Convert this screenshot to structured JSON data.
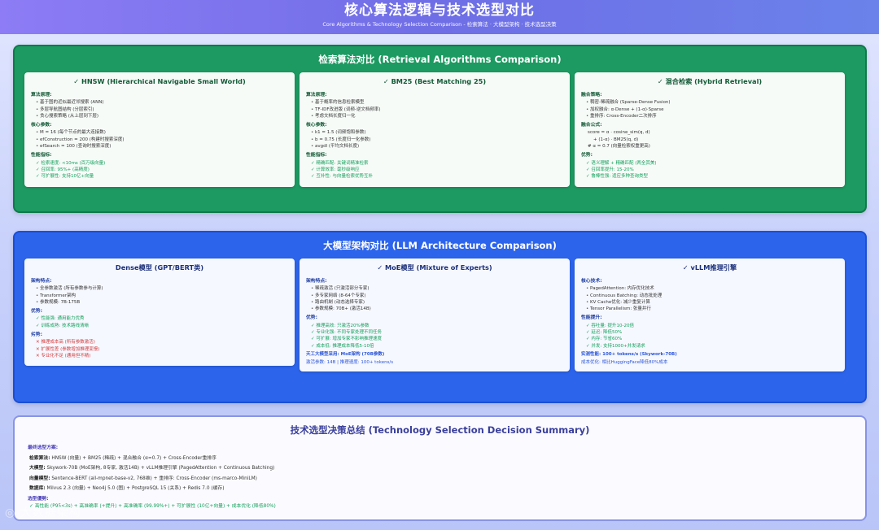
{
  "header": {
    "title": "核心算法逻辑与技术选型对比",
    "subtitle": "Core Algorithms & Technology Selection Comparison - 检索算法 · 大模型架构 · 技术选型决策"
  },
  "retrieval": {
    "title": "检索算法对比 (Retrieval Algorithms Comparison)",
    "cards": [
      {
        "title": "✓ HNSW (Hierarchical Navigable Small World)",
        "s1": "算法原理:",
        "l1": [
          "基于图的近似最近邻搜索 (ANN)",
          "多层导航图结构 (分层索引)",
          "贪心搜索策略 (从上层到下层)"
        ],
        "s2": "核心参数:",
        "l2": [
          "M = 16 (每个节点的最大连接数)",
          "efConstruction = 200 (构建时搜索深度)",
          "efSearch = 100 (查询时搜索深度)"
        ],
        "s3": "性能指标:",
        "l3": [
          "检索速度: <10ms (百万级向量)",
          "召回率: 95%+ (高精度)",
          "可扩展性: 支持10亿+向量"
        ]
      },
      {
        "title": "✓ BM25 (Best Matching 25)",
        "s1": "算法原理:",
        "l1": [
          "基于概率的信息检索模型",
          "TF-IDF改进版 (词频-逆文档频率)",
          "考虑文档长度归一化"
        ],
        "s2": "核心参数:",
        "l2": [
          "k1 = 1.5 (词频饱和参数)",
          "b = 0.75 (长度归一化参数)",
          "avgdl (平均文档长度)"
        ],
        "s3": "性能指标:",
        "l3": [
          "精确匹配: 关键词精准检索",
          "计算效率: 毫秒级响应",
          "互补性: 与向量检索优势互补"
        ]
      },
      {
        "title": "✓ 混合检索 (Hybrid Retrieval)",
        "s1": "融合策略:",
        "l1": [
          "稠密-稀疏融合 (Sparse-Dense Fusion)",
          "加权融合: α·Dense + (1-α)·Sparse",
          "重排序: Cross-Encoder二次排序"
        ],
        "s2": "融合公式:",
        "formula": [
          "score = α · cosine_sim(q, d)",
          "    + (1-α) · BM25(q, d)",
          "# α = 0.7 (向量检索权重更高)"
        ],
        "s3": "优势:",
        "l3": [
          "语义理解 + 精确匹配 (两全其美)",
          "召回率提升: 15-20%",
          "鲁棒性强: 适应多种查询类型"
        ]
      }
    ]
  },
  "llm": {
    "title": "大模型架构对比 (LLM Architecture Comparison)",
    "cards": [
      {
        "title": "Dense模型 (GPT/BERT类)",
        "s1": "架构特点:",
        "l1": [
          "全参数激活 (所有参数参与计算)",
          "Transformer架构",
          "参数规模: 7B-175B"
        ],
        "s2": "优势:",
        "l2": [
          "性能强: 通用能力优秀",
          "训练成熟: 技术路线清晰"
        ],
        "s3": "劣势:",
        "l3": [
          "推理成本高 (所有参数激活)",
          "扩展性差 (参数增加推理变慢)",
          "专业化不足 (通用但不精)"
        ]
      },
      {
        "title": "✓ MoE模型 (Mixture of Experts)",
        "s1": "架构特点:",
        "l1": [
          "稀疏激活 (只激活部分专家)",
          "多专家网络 (8-64个专家)",
          "路由机制 (动态选择专家)",
          "参数规模: 70B+ (激活14B)"
        ],
        "s2": "优势:",
        "l2": [
          "推理高效: 只激活20%参数",
          "专业化强: 不同专家处理不同任务",
          "可扩展: 增加专家不影响推理速度",
          "成本低: 推理成本降低5-10倍"
        ],
        "note1": "天工大模型采用: MoE架构 (70B参数)",
        "note2": "激活参数: 14B | 推理速度: 100+ tokens/s"
      },
      {
        "title": "✓ vLLM推理引擎",
        "s1": "核心技术:",
        "l1": [
          "PagedAttention: 内存优化技术",
          "Continuous Batching: 动态批处理",
          "KV Cache优化: 减少重复计算",
          "Tensor Parallelism: 张量并行"
        ],
        "s2": "性能提升:",
        "l2": [
          "吞吐量: 提升10-20倍",
          "延迟: 降低50%",
          "内存: 节省60%",
          "并发: 支持1000+并发请求"
        ],
        "note1": "实测性能: 100+ tokens/s (Skywork-70B)",
        "note2": "成本优化: 相比HuggingFace降低80%成本"
      }
    ]
  },
  "summary": {
    "title": "技术选型决策总结 (Technology Selection Decision Summary)",
    "final_label": "最终选型方案:",
    "rows": [
      {
        "k": "检索算法:",
        "v": " HNSW (向量) + BM25 (稀疏) + 混合融合 (α=0.7) + Cross-Encoder重排序"
      },
      {
        "k": "大模型:",
        "v": " Skywork-70B (MoE架构, 8专家, 激活14B) + vLLM推理引擎 (PagedAttention + Continuous Batching)"
      },
      {
        "k": "向量模型:",
        "v": " Sentence-BERT (all-mpnet-base-v2, 768维) + 重排序: Cross-Encoder (ms-marco-MiniLM)"
      },
      {
        "k": "数据库:",
        "v": " Milvus 2.3 (向量) + Neo4j 5.0 (图) + PostgreSQL 15 (关系) + Redis 7.0 (缓存)"
      }
    ],
    "adv_label": "选型優勢:",
    "adv_text": "✓ 高性能 (P95<3s) + 高准确率 (+提升) + 高准确率 (99.99%+) + 可扩展性 (10亿+向量) + 成本优化 (降低80%)"
  },
  "watermark": "◎ 大数据架构"
}
